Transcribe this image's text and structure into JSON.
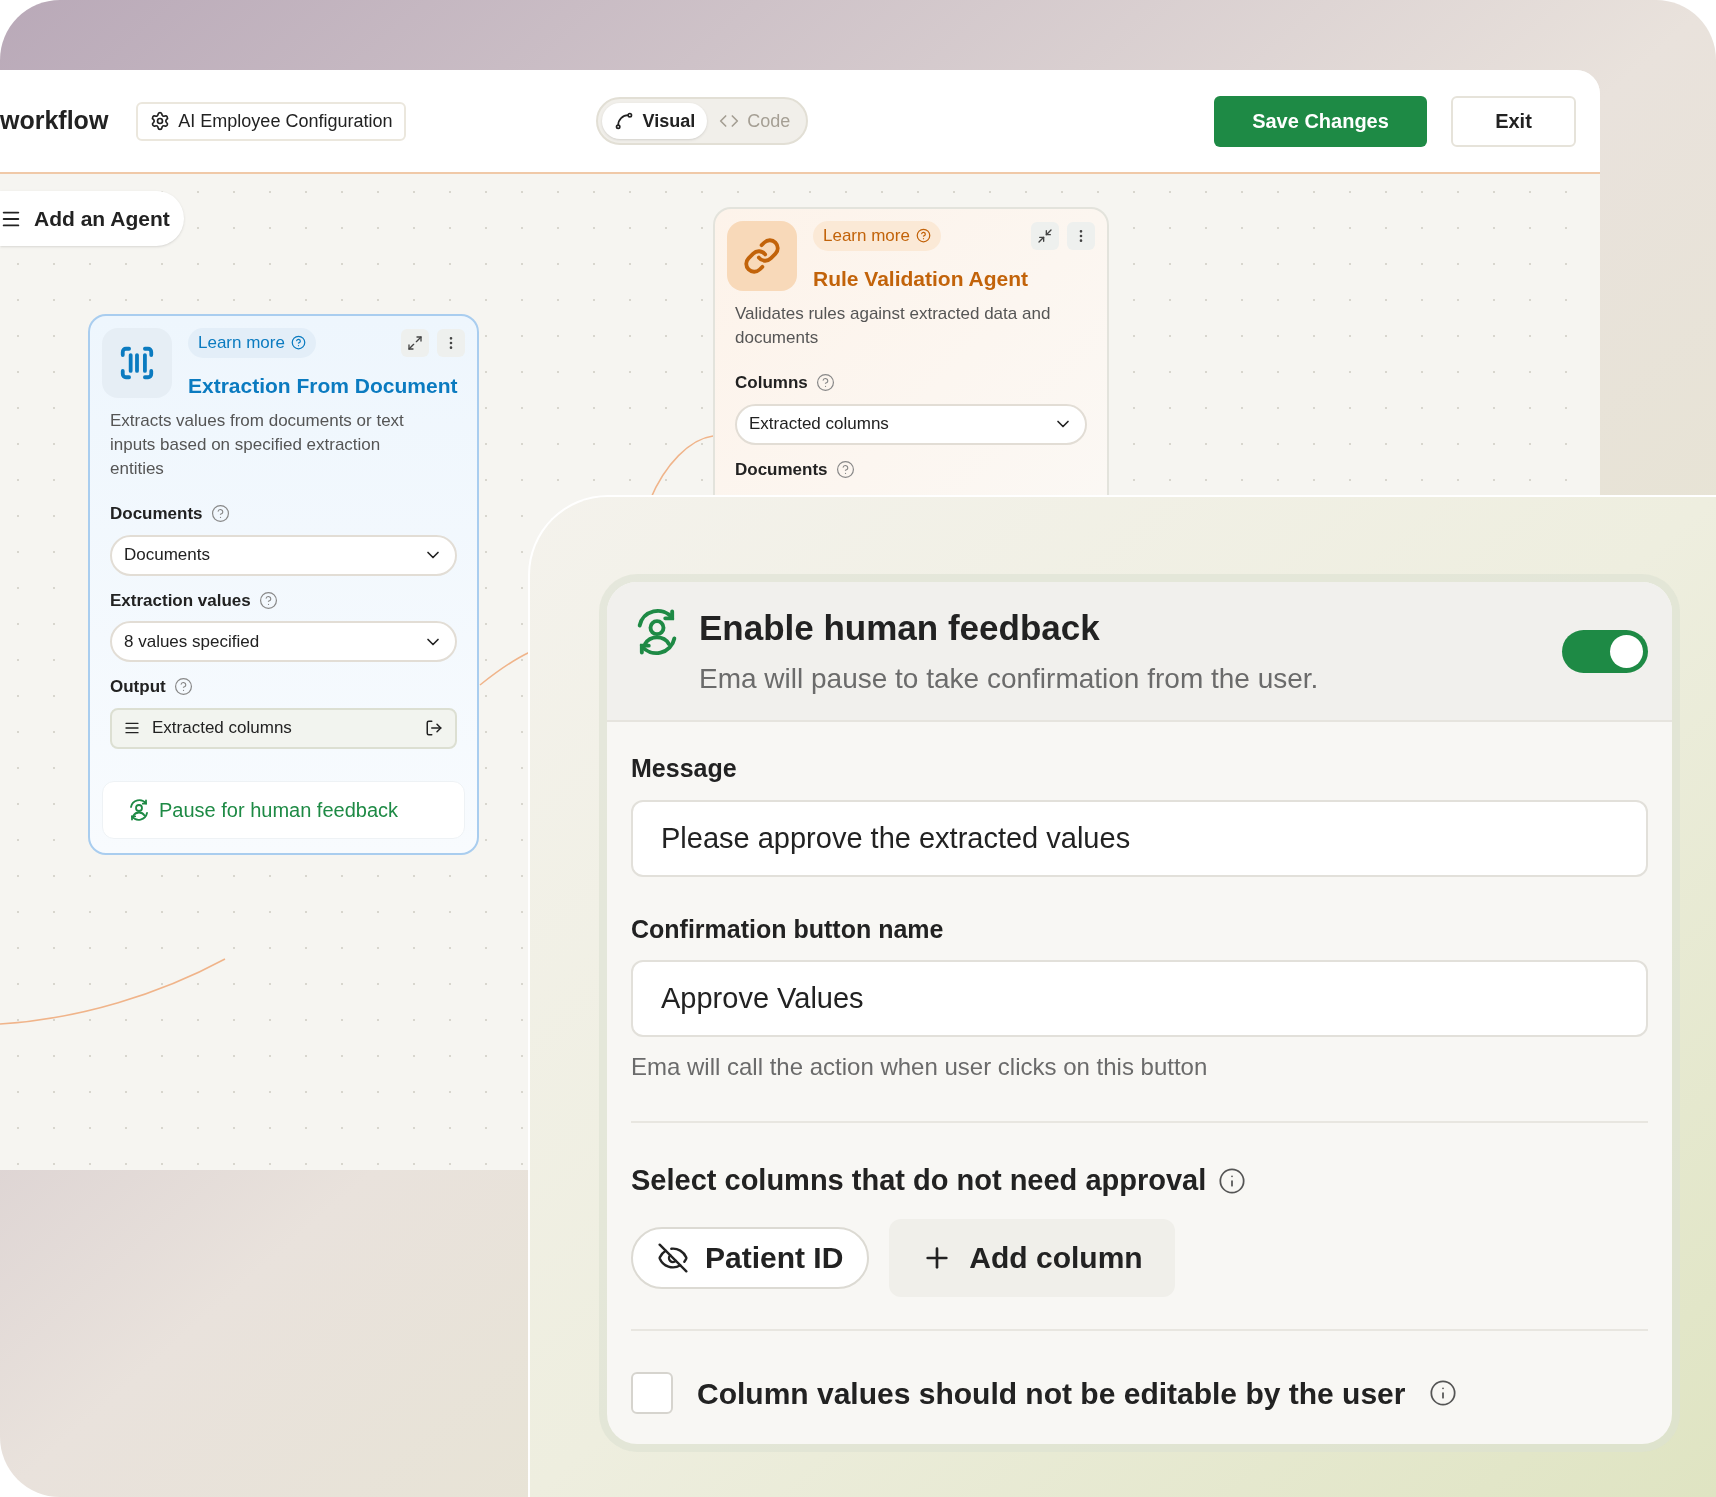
{
  "header": {
    "title": "workflow",
    "config_button": "AI Employee Configuration",
    "view_toggle": [
      {
        "label": "Visual",
        "selected": true
      },
      {
        "label": "Code",
        "selected": false
      }
    ],
    "save_button": "Save Changes",
    "exit_button": "Exit"
  },
  "canvas": {
    "add_agent_button": "Add an Agent",
    "agents": [
      {
        "kind": "extraction",
        "color": "#0b7bc0",
        "expanded": false,
        "learn_more": "Learn more",
        "title": "Extraction From Document",
        "description": "Extracts values from documents or text inputs based on specified extraction entities",
        "fields": [
          {
            "label": "Documents",
            "kind": "dropdown",
            "value": "Documents"
          },
          {
            "label": "Extraction values",
            "kind": "dropdown",
            "value": "8 values specified"
          },
          {
            "label": "Output",
            "kind": "output",
            "value": "Extracted columns"
          }
        ],
        "footer": "Pause for human feedback"
      },
      {
        "kind": "validation",
        "color": "#c2630a",
        "expanded": true,
        "learn_more": "Learn more",
        "title": "Rule Validation Agent",
        "description": "Validates rules against extracted data and documents",
        "fields": [
          {
            "label": "Columns",
            "kind": "dropdown",
            "value": "Extracted columns"
          },
          {
            "label": "Documents",
            "kind": "label"
          }
        ]
      }
    ]
  },
  "feedback_panel": {
    "title": "Enable human feedback",
    "subtitle": "Ema will pause to take confirmation from the user.",
    "on": true,
    "message": {
      "label": "Message",
      "value": "Please approve the extracted values"
    },
    "confirmation": {
      "label": "Confirmation button name",
      "value": "Approve Values",
      "hint": "Ema will call the action when user clicks on this button"
    },
    "columns_title": "Select columns that do not need approval",
    "columns": [
      {
        "label": "Patient ID",
        "kind": "column"
      },
      {
        "label": "Add column",
        "kind": "add"
      }
    ],
    "checkbox": {
      "label": "Column values should not be editable by the user",
      "checked": false
    }
  }
}
